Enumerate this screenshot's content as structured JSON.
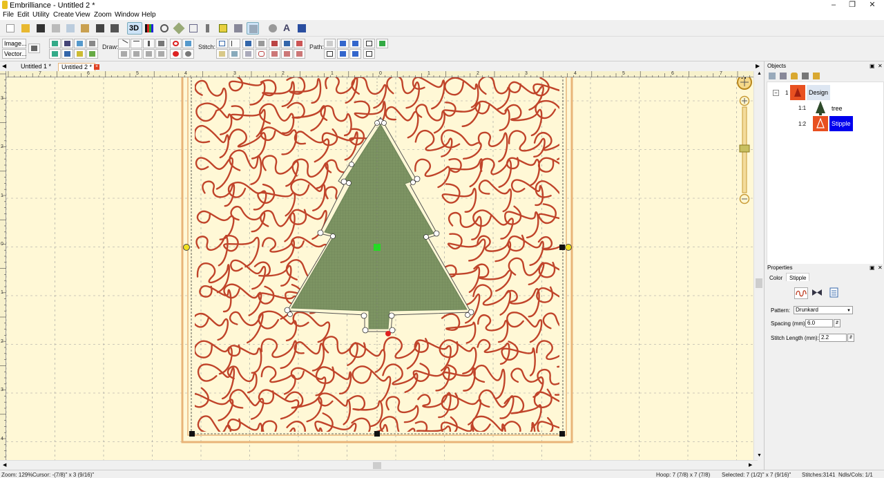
{
  "window": {
    "title": "Embrilliance - Untitled 2 *"
  },
  "menu": [
    "File",
    "Edit",
    "Utility",
    "Create",
    "View",
    "Zoom",
    "Window",
    "Help"
  ],
  "toolbar": {
    "label_3d": "3D",
    "image_button": "Image...",
    "vector_button": "Vector...",
    "draw_label": "Draw:",
    "stitch_label": "Stitch:",
    "path_label": "Path:"
  },
  "tabs": [
    {
      "label": "Untitled 1 *",
      "active": false
    },
    {
      "label": "Untitled 2 *",
      "active": true
    }
  ],
  "ruler": {
    "h_labels": [
      "IN",
      "7",
      "6",
      "5",
      "4",
      "3",
      "2",
      "1",
      "0",
      "1",
      "2",
      "3",
      "4",
      "5",
      "6",
      "7"
    ],
    "v_labels": [
      "3",
      "2",
      "1",
      "0",
      "1",
      "2",
      "3",
      "4"
    ],
    "compass": "N"
  },
  "objects_panel": {
    "title": "Objects",
    "tree": [
      {
        "index": "1",
        "label": "Design"
      },
      {
        "index": "1:1",
        "label": "tree"
      },
      {
        "index": "1:2",
        "label": "Stipple"
      }
    ]
  },
  "properties_panel": {
    "title": "Properties",
    "tabs": [
      "Color",
      "Stipple"
    ],
    "pattern_label": "Pattern:",
    "pattern_value": "Drunkard",
    "spacing_label": "Spacing (mm):",
    "spacing_value": "6.0",
    "stitch_length_label": "Stitch Length (mm):",
    "stitch_length_value": "2.2"
  },
  "status": {
    "zoom": "Zoom: 129%",
    "cursor": "Cursor: -(7/8)\" x 3 (9/16)\"",
    "hoop": "Hoop: 7 (7/8) x 7 (7/8)",
    "selected": "Selected: 7 (1/2)\" x 7 (9/16)\"",
    "stitches": "Stitches:3141",
    "ndls": "Ndls/Cols: 1/1"
  },
  "colors": {
    "canvas": "#fff8d6",
    "hoop": "#e8b478",
    "stipple": "#c0442a",
    "tree": "#7d9463",
    "selected_highlight": "#0000ee"
  }
}
